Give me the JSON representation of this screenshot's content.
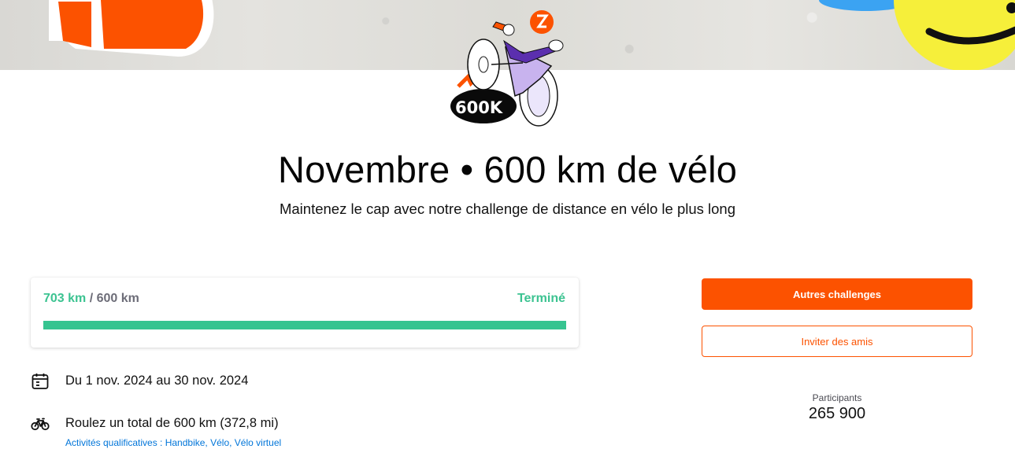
{
  "challenge": {
    "title": "Novembre • 600 km de vélo",
    "subtitle": "Maintenez le cap avec notre challenge de distance en vélo le plus long",
    "badge_text": "600K"
  },
  "progress": {
    "current": "703 km",
    "separator": " / ",
    "goal": "600 km",
    "status": "Terminé",
    "fraction": 1.0
  },
  "details": {
    "dates": "Du 1 nov. 2024 au 30 nov. 2024",
    "goal_text": "Roulez un total de 600 km (372,8 mi)",
    "qualifying_prefix": "Activités qualificatives : ",
    "qualifying": [
      {
        "label": "Handbike",
        "sep": ", "
      },
      {
        "label": "Vélo",
        "sep": ", "
      },
      {
        "label": "Vélo virtuel",
        "sep": ""
      }
    ]
  },
  "actions": {
    "other_challenges": "Autres challenges",
    "invite_friends": "Inviter des amis"
  },
  "stats": {
    "participants_label": "Participants",
    "participants_value": "265 900"
  },
  "icons": {
    "dates": "calendar-icon",
    "goal": "bike-icon"
  },
  "colors": {
    "brand": "#fc5200",
    "complete": "#3cc391",
    "link": "#0075d9"
  }
}
